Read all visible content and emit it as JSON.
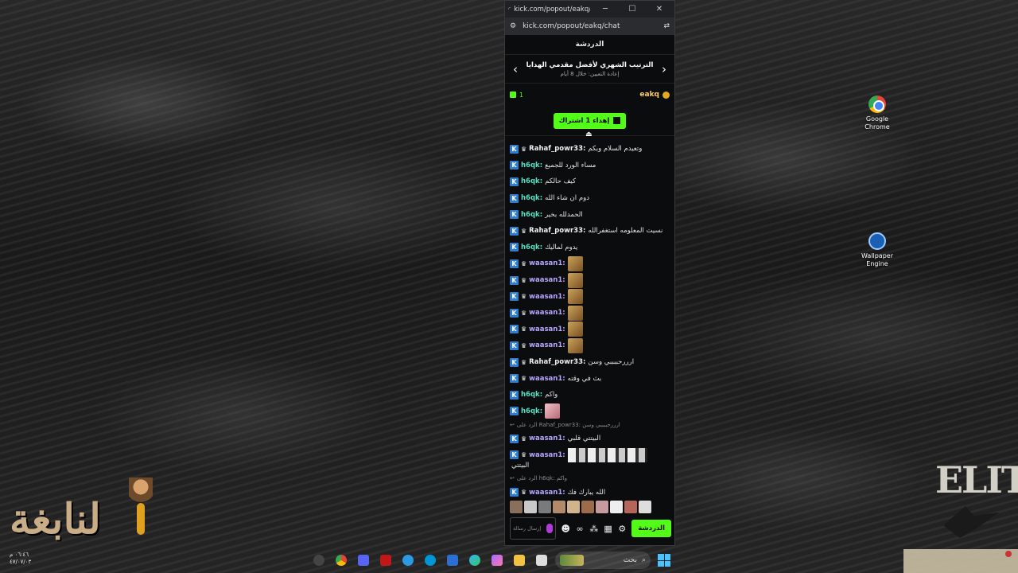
{
  "window": {
    "title": "kick.com/popout/eakq/chat...",
    "url": "kick.com/popout/eakq/chat"
  },
  "chat": {
    "header": "الدردشة",
    "leaderboard": {
      "title": "الترتيب الشهري لأفضل مقدمي الهدايا",
      "subtitle": "إعادة التعيين: خلال 8 أيام"
    },
    "top_gifter": {
      "count": "1",
      "name": "eakq"
    },
    "gift_button": "إهداء 1 اشتراك",
    "messages": [
      {
        "user": "Rahaf_powr33:",
        "color": "white",
        "crown": true,
        "text": "وتعيدم السلام وبكم"
      },
      {
        "user": "h6qk:",
        "color": "teal",
        "crown": false,
        "text": "مساء الورد للجميع"
      },
      {
        "user": "h6qk:",
        "color": "teal",
        "crown": false,
        "text": "كيف حالكم"
      },
      {
        "user": "h6qk:",
        "color": "teal",
        "crown": false,
        "text": "دوم ان شاء الله"
      },
      {
        "user": "h6qk:",
        "color": "teal",
        "crown": false,
        "text": "الحمدلله بخير"
      },
      {
        "user": "Rahaf_powr33:",
        "color": "white",
        "crown": true,
        "text": "نسيت المعلومه استغفرالله"
      },
      {
        "user": "h6qk:",
        "color": "teal",
        "crown": false,
        "text": "يدوم لماليك"
      },
      {
        "user": "waasan1:",
        "color": "purple",
        "crown": true,
        "emote": "gold"
      },
      {
        "user": "waasan1:",
        "color": "purple",
        "crown": true,
        "emote": "gold"
      },
      {
        "user": "waasan1:",
        "color": "purple",
        "crown": true,
        "emote": "gold"
      },
      {
        "user": "waasan1:",
        "color": "purple",
        "crown": true,
        "emote": "gold"
      },
      {
        "user": "waasan1:",
        "color": "purple",
        "crown": true,
        "emote": "gold"
      },
      {
        "user": "waasan1:",
        "color": "purple",
        "crown": true,
        "emote": "gold"
      },
      {
        "user": "Rahaf_powr33:",
        "color": "white",
        "crown": true,
        "text": "ارررحببببي وسن"
      },
      {
        "user": "waasan1:",
        "color": "purple",
        "crown": true,
        "text": "بث في وقته"
      },
      {
        "user": "h6qk:",
        "color": "teal",
        "crown": false,
        "text": "واكم"
      },
      {
        "user": "h6qk:",
        "color": "teal",
        "crown": false,
        "emote": "pink"
      },
      {
        "reply": "الرد على Rahaf_powr33: ارررحببببي وسن"
      },
      {
        "user": "waasan1:",
        "color": "purple",
        "crown": true,
        "text": "البيتتي قلبي"
      },
      {
        "user": "waasan1:",
        "color": "purple",
        "crown": true,
        "emote": "strip",
        "wrap": "البيتتي"
      },
      {
        "reply": "الرد على h6qk: واكم"
      },
      {
        "user": "waasan1:",
        "color": "purple",
        "crown": true,
        "text": "الله يبارك فك"
      }
    ],
    "input_placeholder": "إرسال رسالة",
    "chat_button": "الدردشة"
  },
  "desktop": {
    "icons": [
      {
        "label": "Google Chrome"
      },
      {
        "label": "Wallpaper Engine"
      }
    ],
    "clock": {
      "time": "٠٦:٤٦ م",
      "date": "٤٧/٠٧/٠٣"
    },
    "search_text": "بحث"
  },
  "colors": {
    "accent": "#53fc18",
    "panel": "#0b0c0d"
  }
}
